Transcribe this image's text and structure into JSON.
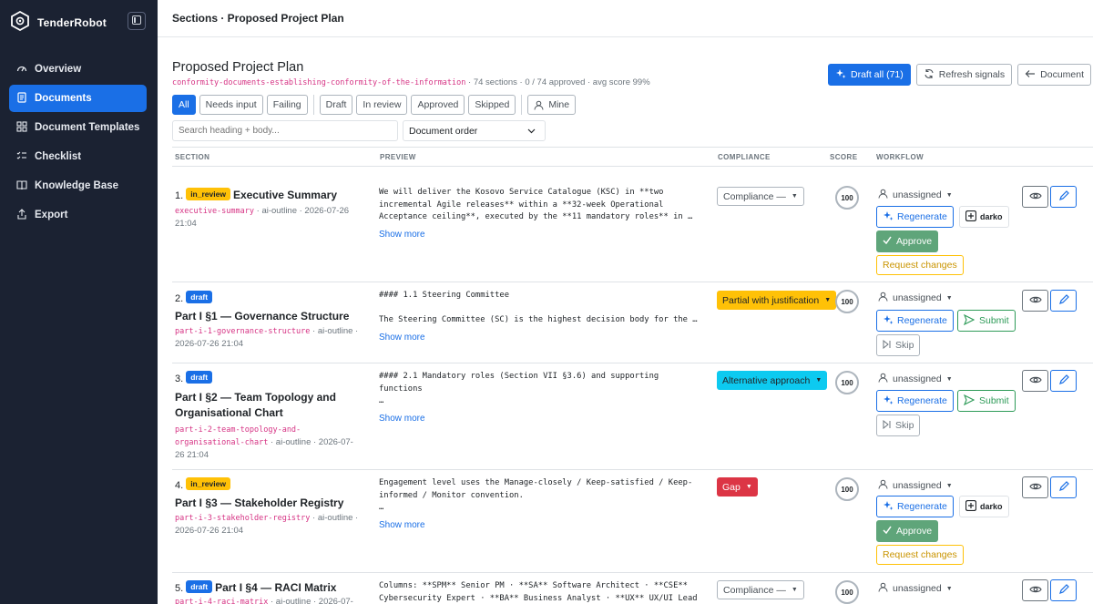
{
  "app": {
    "name": "TenderRobot",
    "brand_display": "TenderRobot"
  },
  "sidebar": {
    "items": [
      {
        "label": "Overview",
        "icon": "speedometer-icon",
        "active": false
      },
      {
        "label": "Documents",
        "icon": "document-icon",
        "active": true
      },
      {
        "label": "Document Templates",
        "icon": "template-icon",
        "active": false
      },
      {
        "label": "Checklist",
        "icon": "checklist-icon",
        "active": false
      },
      {
        "label": "Knowledge Base",
        "icon": "book-icon",
        "active": false
      },
      {
        "label": "Export",
        "icon": "export-icon",
        "active": false
      }
    ]
  },
  "topbar": {
    "breadcrumb": "Sections · Proposed Project Plan"
  },
  "header": {
    "title": "Proposed Project Plan",
    "slug": "conformity-documents-establishing-conformity-of-the-information",
    "stats": " · 74 sections · 0 / 74 approved · avg score 99%",
    "draft_all": "Draft all (71)",
    "refresh": "Refresh signals",
    "back": "Document"
  },
  "filters": {
    "all": "All",
    "needs_input": "Needs input",
    "failing": "Failing",
    "draft": "Draft",
    "in_review": "In review",
    "approved": "Approved",
    "skipped": "Skipped",
    "mine": "Mine"
  },
  "search": {
    "placeholder": "Search heading + body..."
  },
  "order": {
    "selected": "Document order"
  },
  "table": {
    "headers": {
      "section": "SECTION",
      "preview": "PREVIEW",
      "compliance": "COMPLIANCE",
      "score": "SCORE",
      "workflow": "WORKFLOW"
    }
  },
  "rows": [
    {
      "num": "1.",
      "status": "in_review",
      "title": "Executive Summary",
      "slug": "executive-summary",
      "meta": " · ai-outline · 2026-07-26",
      "date2": "21:04",
      "preview": [
        "We will deliver the Kosovo Service Catalogue (KSC) in **two",
        "incremental Agile releases** within a **32-week Operational",
        "Acceptance ceiling**, executed by the **11 mandatory roles** in …"
      ],
      "show_more": "Show more",
      "compliance": "Compliance —",
      "score": "100",
      "assignee": "unassigned",
      "regenerate": "Regenerate",
      "model": "darko",
      "approve": "Approve",
      "request": "Request changes"
    },
    {
      "num": "2.",
      "status": "draft",
      "title": "Part I §1 — Governance Structure",
      "slug": "part-i-1-governance-structure",
      "meta": " · ai-outline ·",
      "date2": "2026-07-26 21:04",
      "preview": [
        "#### 1.1 Steering Committee",
        "",
        "The Steering Committee (SC) is the highest decision body for the …"
      ],
      "show_more": "Show more",
      "compliance": "Partial with justification",
      "score": "100",
      "assignee": "unassigned",
      "regenerate": "Regenerate",
      "submit": "Submit",
      "skip": "Skip"
    },
    {
      "num": "3.",
      "status": "draft",
      "title_l1": "Part I §2 — Team Topology and",
      "title_l2": "Organisational Chart",
      "slug": "part-i-2-team-topology-and-",
      "slug2": "organisational-chart",
      "meta": " · ai-outline · 2026-07-",
      "date2": "26 21:04",
      "preview": [
        "#### 2.1 Mandatory roles (Section VII §3.6) and supporting",
        "functions",
        "…"
      ],
      "show_more": "Show more",
      "compliance": "Alternative approach",
      "score": "100",
      "assignee": "unassigned",
      "regenerate": "Regenerate",
      "submit": "Submit",
      "skip": "Skip"
    },
    {
      "num": "4.",
      "status": "in_review",
      "title": "Part I §3 — Stakeholder Registry",
      "slug": "part-i-3-stakeholder-registry",
      "meta": " · ai-outline ·",
      "date2": "2026-07-26 21:04",
      "preview": [
        "Engagement level uses the Manage-closely / Keep-satisfied / Keep-",
        "informed / Monitor convention.",
        "…"
      ],
      "show_more": "Show more",
      "compliance": "Gap",
      "score": "100",
      "assignee": "unassigned",
      "regenerate": "Regenerate",
      "model": "darko",
      "approve": "Approve",
      "request": "Request changes"
    },
    {
      "num": "5.",
      "status": "draft",
      "title": "Part I §4 — RACI Matrix",
      "slug": "part-i-4-raci-matrix",
      "meta": " · ai-outline · 2026-07-",
      "preview": [
        "Columns: **SPM** Senior PM · **SA** Software Architect · **CSE**",
        "Cybersecurity Expert · **BA** Business Analyst · **UX** UX/UI Lead"
      ],
      "compliance": "Compliance —",
      "score": "100",
      "assignee": "unassigned"
    }
  ],
  "colors": {
    "accent": "#1a6fe6",
    "sidebar": "#1b2232",
    "warning": "#ffc107",
    "info": "#0dcaf0",
    "danger": "#dc3545",
    "success": "#5fa57a"
  }
}
